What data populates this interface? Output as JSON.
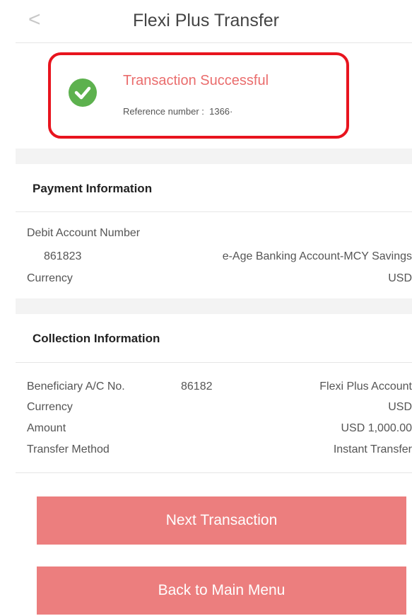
{
  "header": {
    "back_icon": "chevron-left-icon",
    "back_glyph": "<",
    "title": "Flexi Plus Transfer"
  },
  "result": {
    "status_icon": "check-circle-icon",
    "status_color": "#5db14e",
    "title": "Transaction Successful",
    "title_color": "#ea6d6d",
    "reference_label": "Reference number :  1366·"
  },
  "payment": {
    "title": "Payment Information",
    "debit_label": "Debit Account Number",
    "debit_number": "861823",
    "debit_account_type": "e-Age Banking Account-MCY Savings",
    "currency_label": "Currency",
    "currency_value": "USD"
  },
  "collection": {
    "title": "Collection Information",
    "beneficiary_label": "Beneficiary A/C No.",
    "beneficiary_number": "86182",
    "beneficiary_account_type": "Flexi Plus Account",
    "currency_label": "Currency",
    "currency_value": "USD",
    "amount_label": "Amount",
    "amount_value": "USD 1,000.00",
    "method_label": "Transfer Method",
    "method_value": "Instant Transfer"
  },
  "actions": {
    "next_label": "Next Transaction",
    "main_menu_label": "Back to Main Menu",
    "button_color": "#ec7e7e"
  },
  "annotation": {
    "highlight_color": "#e8141e"
  }
}
